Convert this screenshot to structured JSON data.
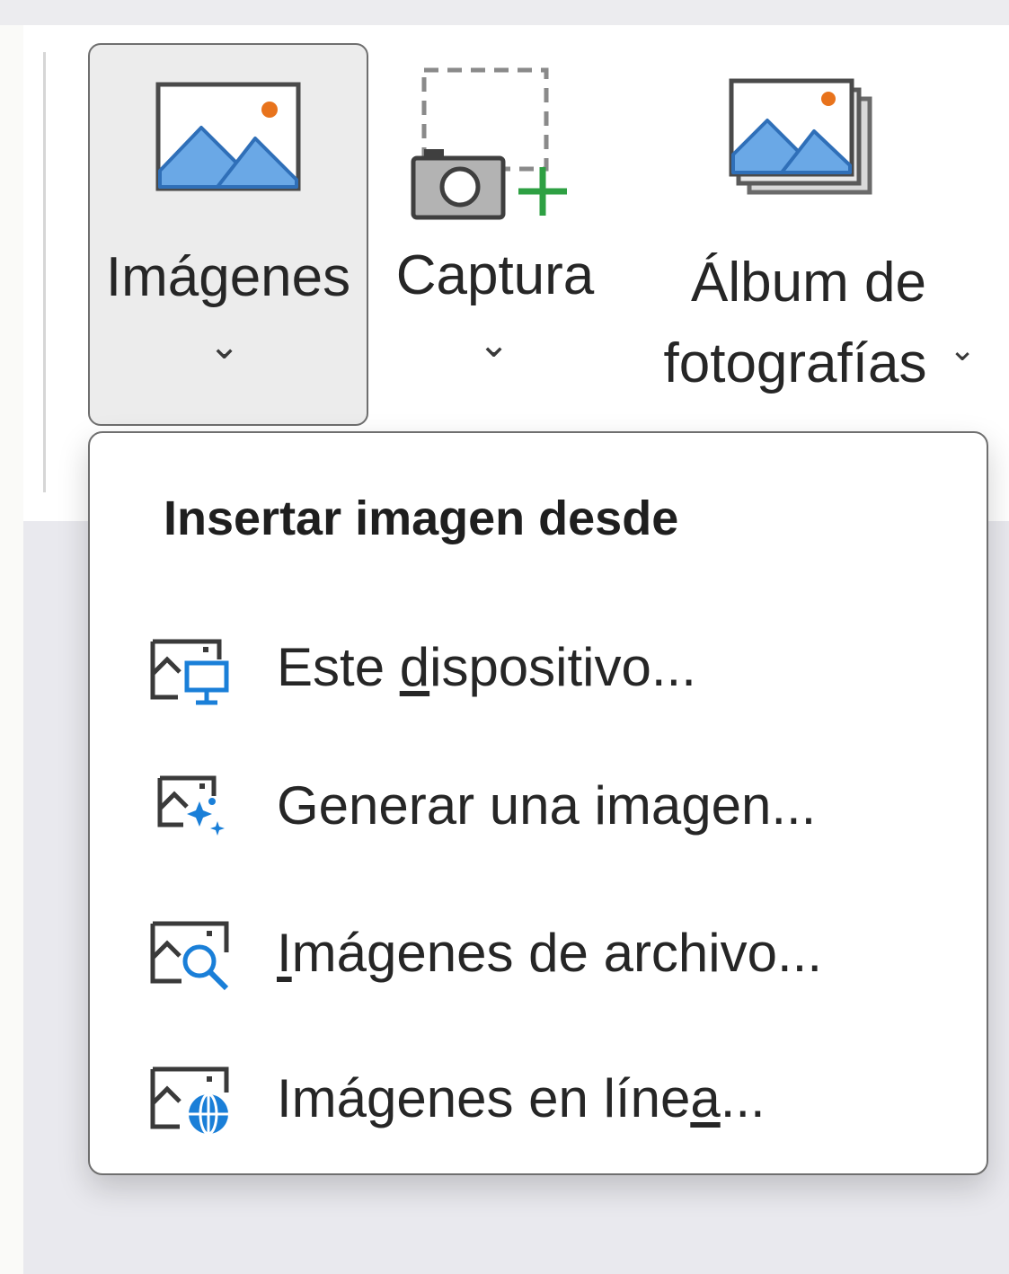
{
  "ribbon": {
    "images_button": {
      "label": "Imágenes",
      "icon": "picture-icon"
    },
    "capture_button": {
      "label": "Captura",
      "icon": "screenshot-camera-icon"
    },
    "album_button": {
      "label_line1": "Álbum de",
      "label_line2": "fotografías",
      "icon": "photo-album-icon"
    }
  },
  "dropdown": {
    "title": "Insertar imagen desde",
    "items": [
      {
        "pre": "Este ",
        "key": "d",
        "post": "ispositivo...",
        "icon": "this-device-icon"
      },
      {
        "pre": "Generar una imagen...",
        "key": "",
        "post": "",
        "icon": "generate-image-icon"
      },
      {
        "pre": "",
        "key": "I",
        "post": "mágenes de archivo...",
        "icon": "stock-images-icon"
      },
      {
        "pre": "Imágenes en líne",
        "key": "a",
        "post": "...",
        "icon": "online-images-icon"
      }
    ]
  },
  "colors": {
    "icon_blue": "#6aa8e6",
    "icon_blue_dark": "#2f6fb8",
    "accent_orange": "#e8731c",
    "accent_green": "#2ea043",
    "menu_icon_blue": "#1a7fd8"
  }
}
